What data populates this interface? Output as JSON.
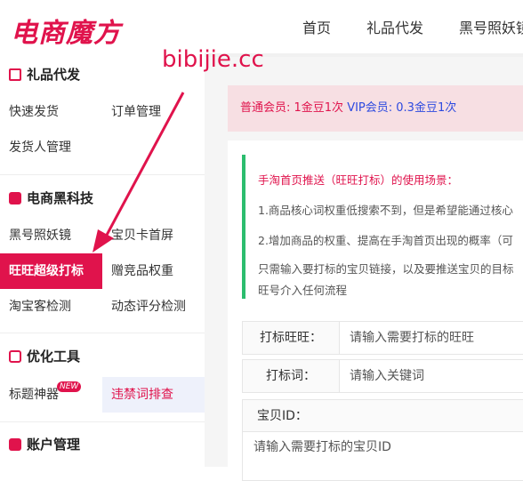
{
  "logo": "电商魔方",
  "watermark": "bibijie.cc",
  "topnav": [
    "首页",
    "礼品代发",
    "黑号照妖镜"
  ],
  "sidebar": {
    "sections": [
      {
        "title": "礼品代发",
        "icon": "gift-bag-icon"
      },
      {
        "title": "电商黑科技",
        "icon": "mail-icon"
      },
      {
        "title": "优化工具",
        "icon": "search-doc-icon"
      },
      {
        "title": "账户管理",
        "icon": "bar-chart-icon"
      }
    ],
    "items": [
      "快速发货",
      "订单管理",
      "发货人管理",
      "黑号照妖镜",
      "宝贝卡首屏",
      "旺旺超级打标",
      "赠竞品权重",
      "淘宝客检测",
      "动态评分检测",
      "标题神器",
      "违禁词排查"
    ],
    "new_badge": "NEW"
  },
  "notice": {
    "normal": "普通会员: 1金豆1次",
    "vip": "VIP会员: 0.3金豆1次"
  },
  "tip": {
    "title": "手淘首页推送（旺旺打标）的使用场景：",
    "line1": "1.商品核心词权重低搜索不到，但是希望能通过核心",
    "line2": "2.增加商品的权重、提高在手淘首页出现的概率（可",
    "line3": "只需输入要打标的宝贝链接，以及要推送宝贝的目标",
    "line4": "旺号介入任何流程"
  },
  "form": {
    "wangwang_label": "打标旺旺：",
    "wangwang_placeholder": "请输入需要打标的旺旺",
    "keyword_label": "打标词：",
    "keyword_placeholder": "请输入关键词",
    "itemid_label": "宝贝ID：",
    "itemid_placeholder": "请输入需要打标的宝贝ID"
  },
  "colors": {
    "brand": "#e0134c",
    "vip": "#2d4ae0",
    "tip_border": "#2bbd6e",
    "notice_bg": "#f7dfe3"
  }
}
